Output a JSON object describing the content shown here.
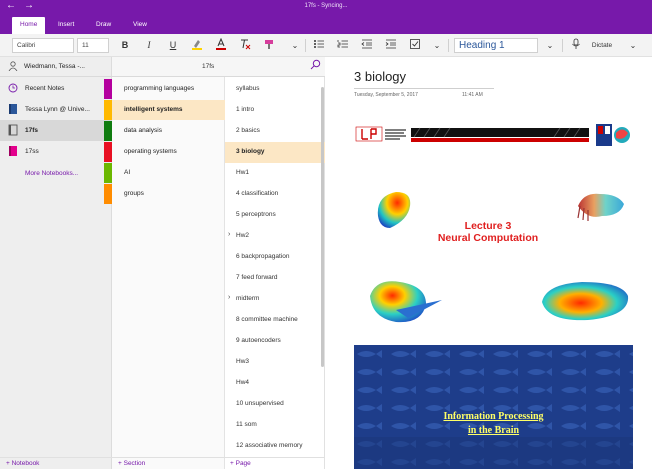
{
  "window": {
    "title": "17fs - Syncing...",
    "back_glyph": "←",
    "forward_glyph": "→"
  },
  "ribbon_tabs": [
    {
      "label": "Home",
      "active": true
    },
    {
      "label": "Insert",
      "active": false
    },
    {
      "label": "Draw",
      "active": false
    },
    {
      "label": "View",
      "active": false
    }
  ],
  "toolbar": {
    "font_name": "Calibri",
    "font_size": "11",
    "bold": "B",
    "italic": "I",
    "underline": "U",
    "style": "Heading 1",
    "dictate": "Dictate"
  },
  "account": {
    "name": "Wiedmann, Tessa -..."
  },
  "notebooks": [
    {
      "label": "Recent Notes",
      "icon": "clock-icon"
    },
    {
      "label": "Tessa Lynn @ Unive...",
      "icon": "notebook-icon"
    },
    {
      "label": "17fs",
      "icon": "notebook-icon",
      "selected": true
    },
    {
      "label": "17ss",
      "icon": "notebook-icon"
    }
  ],
  "more_notebooks": "More Notebooks...",
  "section_header": "17fs",
  "sections": [
    {
      "label": "programming languages",
      "color": "#b4009e"
    },
    {
      "label": "intelligent systems",
      "color": "#ffb900",
      "selected": true
    },
    {
      "label": "data analysis",
      "color": "#107c10"
    },
    {
      "label": "operating systems",
      "color": "#e81123"
    },
    {
      "label": "AI",
      "color": "#6bb700"
    },
    {
      "label": "groups",
      "color": "#ff8c00"
    }
  ],
  "pages": [
    {
      "label": "syllabus"
    },
    {
      "label": "1 intro"
    },
    {
      "label": "2 basics"
    },
    {
      "label": "3 biology",
      "selected": true
    },
    {
      "label": "Hw1"
    },
    {
      "label": "4 classification"
    },
    {
      "label": "5 perceptrons"
    },
    {
      "label": "Hw2",
      "collapsed": true
    },
    {
      "label": "6 backpropagation"
    },
    {
      "label": "7 feed forward"
    },
    {
      "label": "midterm",
      "collapsed": true
    },
    {
      "label": "8 committee machine"
    },
    {
      "label": "9 autoencoders"
    },
    {
      "label": "Hw3"
    },
    {
      "label": "Hw4"
    },
    {
      "label": "10 unsupervised"
    },
    {
      "label": "11 som"
    },
    {
      "label": "12 associative memory"
    }
  ],
  "bottom": {
    "notebook": "Notebook",
    "section": "Section",
    "page": "Page"
  },
  "page": {
    "title": "3 biology",
    "date": "Tuesday, September 5, 2017",
    "time": "11:41 AM",
    "lecture_line1": "Lecture 3",
    "lecture_line2": "Neural Computation",
    "slide2_line1": "Information Processing",
    "slide2_line2": "in the Brain"
  },
  "colors": {
    "accent": "#7719aa",
    "lecture": "#e02020",
    "slide_bg": "#1e3d8a",
    "slide_text": "#ffff66"
  }
}
